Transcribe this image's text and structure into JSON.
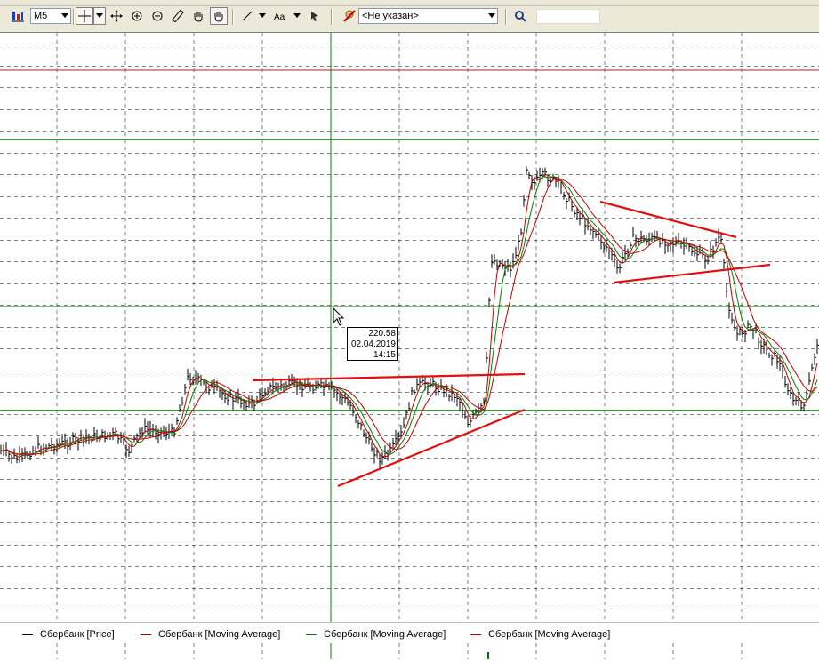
{
  "toolbar": {
    "timeframe": "M5",
    "instrument": "<Не указан>"
  },
  "tooltip": {
    "price": "220.58",
    "date": "02.04.2019",
    "time": "14:15"
  },
  "legend": [
    {
      "label": "Сбербанк [Price]",
      "color": "#000000"
    },
    {
      "label": "Сбербанк [Moving Average]",
      "color": "#c00000"
    },
    {
      "label": "Сбербанк [Moving Average]",
      "color": "#008000"
    },
    {
      "label": "Сбербанк [Moving Average]",
      "color": "#c00000"
    }
  ],
  "colors": {
    "level_line": "#007000",
    "trend_line": "#e01010",
    "grid": "#000000",
    "toolbar_bg": "#ece9d8"
  }
}
